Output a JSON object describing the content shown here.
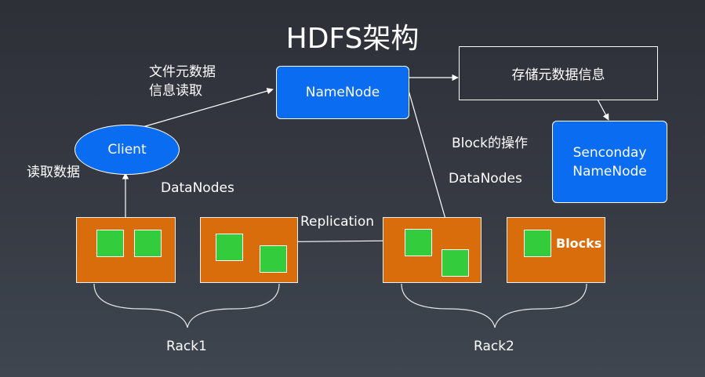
{
  "title": "HDFS架构",
  "nodes": {
    "namenode": "NameNode",
    "secondary": "Senconday\nNameNode",
    "client": "Client",
    "store_meta": "存储元数据信息"
  },
  "labels": {
    "meta_read": "文件元数据\n信息读取",
    "read_data": "读取数据",
    "block_ops": "Block的操作",
    "datanodes_left": "DataNodes",
    "datanodes_right": "DataNodes",
    "replication": "Replication",
    "blocks": "Blocks",
    "rack1": "Rack1",
    "rack2": "Rack2"
  },
  "colors": {
    "node_blue": "#0a6cf0",
    "datanode_orange": "#d96d0c",
    "block_green": "#33cc3c"
  }
}
